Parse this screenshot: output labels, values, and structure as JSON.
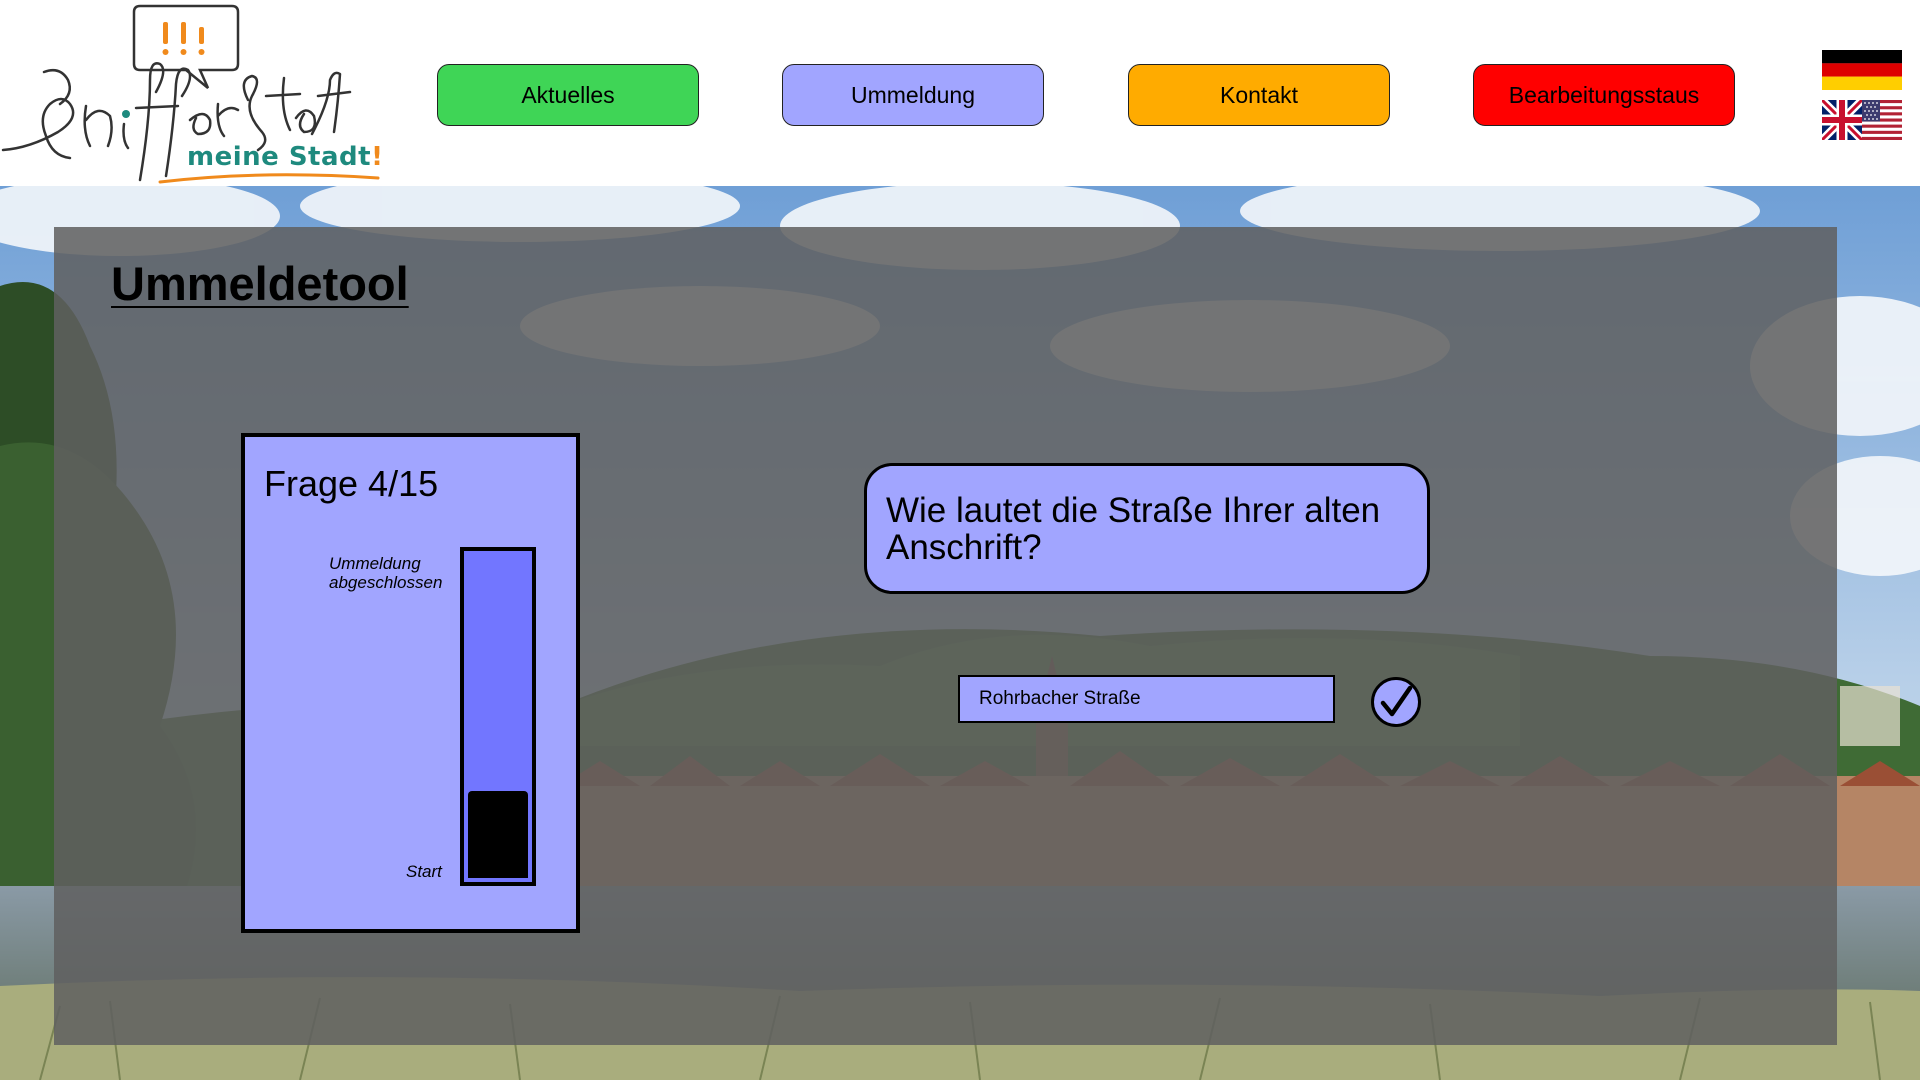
{
  "header": {
    "logo": {
      "script_text": "Schifferstadt",
      "sub_text": "meine Stadt",
      "sub_bang": "!",
      "bubble_text": "!!!"
    },
    "nav": [
      {
        "label": "Aktuelles",
        "color": "#3fd556"
      },
      {
        "label": "Ummeldung",
        "color": "#a1a5ff"
      },
      {
        "label": "Kontakt",
        "color": "#ffab00"
      },
      {
        "label": "Bearbeitungsstaus",
        "color": "#ff0000"
      }
    ],
    "languages": [
      {
        "name": "flag-de-icon",
        "language": "Deutsch"
      },
      {
        "name": "flag-en-icon",
        "language": "English"
      }
    ]
  },
  "main": {
    "title": "Ummeldetool",
    "progress": {
      "question_label": "Frage 4/15",
      "current_question": 4,
      "total_questions": 15,
      "top_label": "Ummeldung abgeschlossen",
      "bottom_label": "Start",
      "fill_fraction": 0.27
    },
    "question": "Wie lautet die Straße Ihrer alten Anschrift?",
    "answer": {
      "value": "Rohrbacher Straße"
    },
    "submit_icon": "checkmark-icon"
  },
  "colors": {
    "accent": "#a1a5ff",
    "bar": "#7276ff",
    "logo_teal": "#1e8a7e",
    "logo_orange": "#f08a1c"
  }
}
